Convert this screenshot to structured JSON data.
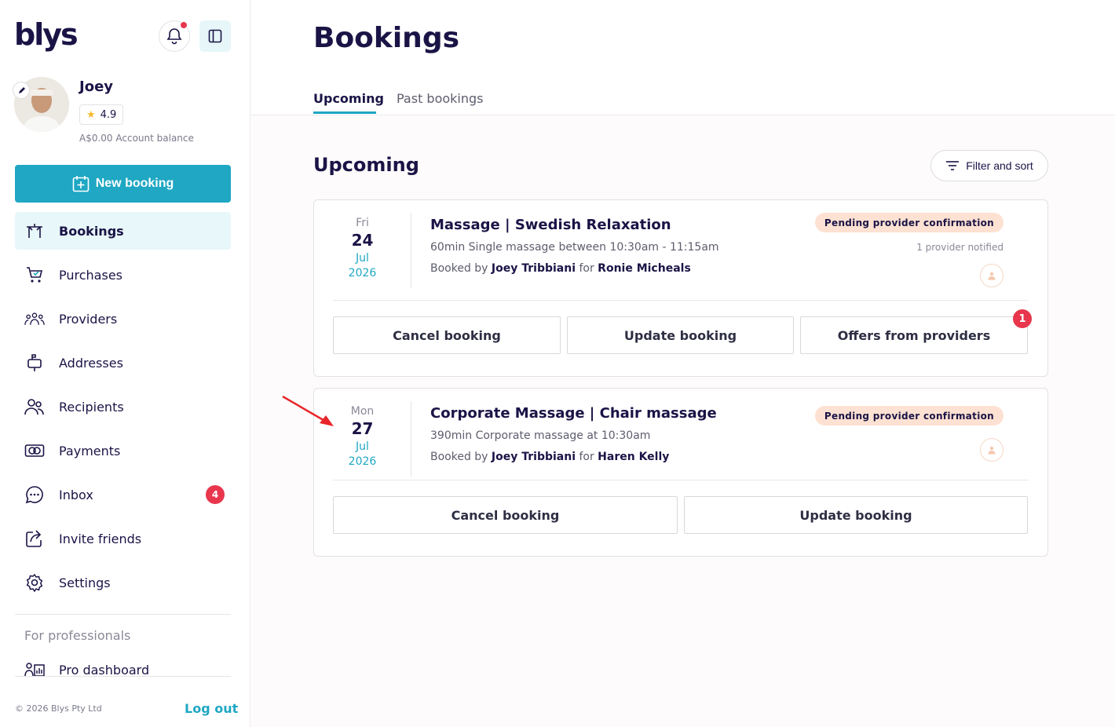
{
  "app": {
    "logo_text": "blys"
  },
  "user": {
    "name": "Joey",
    "rating": "4.9",
    "balance": "A$0.00 Account balance"
  },
  "sidebar": {
    "new_booking_label": "New booking",
    "items": [
      {
        "label": "Bookings",
        "icon": "bookings-icon",
        "active": true
      },
      {
        "label": "Purchases",
        "icon": "cart-icon"
      },
      {
        "label": "Providers",
        "icon": "providers-icon"
      },
      {
        "label": "Addresses",
        "icon": "mailbox-icon"
      },
      {
        "label": "Recipients",
        "icon": "recipients-icon"
      },
      {
        "label": "Payments",
        "icon": "payment-card-icon"
      },
      {
        "label": "Inbox",
        "icon": "chat-icon",
        "badge": "4"
      },
      {
        "label": "Invite friends",
        "icon": "share-icon"
      },
      {
        "label": "Settings",
        "icon": "gear-icon"
      }
    ],
    "pro_section_label": "For professionals",
    "pro_dashboard_label": "Pro dashboard",
    "copyright": "© 2026 Blys Pty Ltd",
    "logout_label": "Log out"
  },
  "main": {
    "title": "Bookings",
    "tabs": [
      {
        "label": "Upcoming",
        "active": true
      },
      {
        "label": "Past bookings",
        "active": false
      }
    ],
    "section_title": "Upcoming",
    "filter_label": "Filter and sort"
  },
  "bookings": [
    {
      "dow": "Fri",
      "day": "24",
      "month": "Jul",
      "year": "2026",
      "title": "Massage | Swedish Relaxation",
      "description": "60min Single massage between 10:30am - 11:15am",
      "booked_by_prefix": "Booked by",
      "booked_by": "Joey Tribbiani",
      "for_word": "for",
      "recipient": "Ronie Micheals",
      "status": "Pending provider confirmation",
      "notified": "1 provider notified",
      "actions": {
        "cancel": "Cancel booking",
        "update": "Update booking",
        "offers": "Offers from providers"
      },
      "offers_count": "1"
    },
    {
      "dow": "Mon",
      "day": "27",
      "month": "Jul",
      "year": "2026",
      "title": "Corporate Massage | Chair massage",
      "description": "390min Corporate massage at 10:30am",
      "booked_by_prefix": "Booked by",
      "booked_by": "Joey Tribbiani",
      "for_word": "for",
      "recipient": "Haren Kelly",
      "status": "Pending provider confirmation",
      "actions": {
        "cancel": "Cancel booking",
        "update": "Update booking"
      }
    }
  ],
  "colors": {
    "brand": "#1fa7c3",
    "navy": "#1a1446",
    "badge_red": "#e8364d",
    "status_bg": "#fde1d2",
    "annotation_arrow": "#e8262a"
  }
}
